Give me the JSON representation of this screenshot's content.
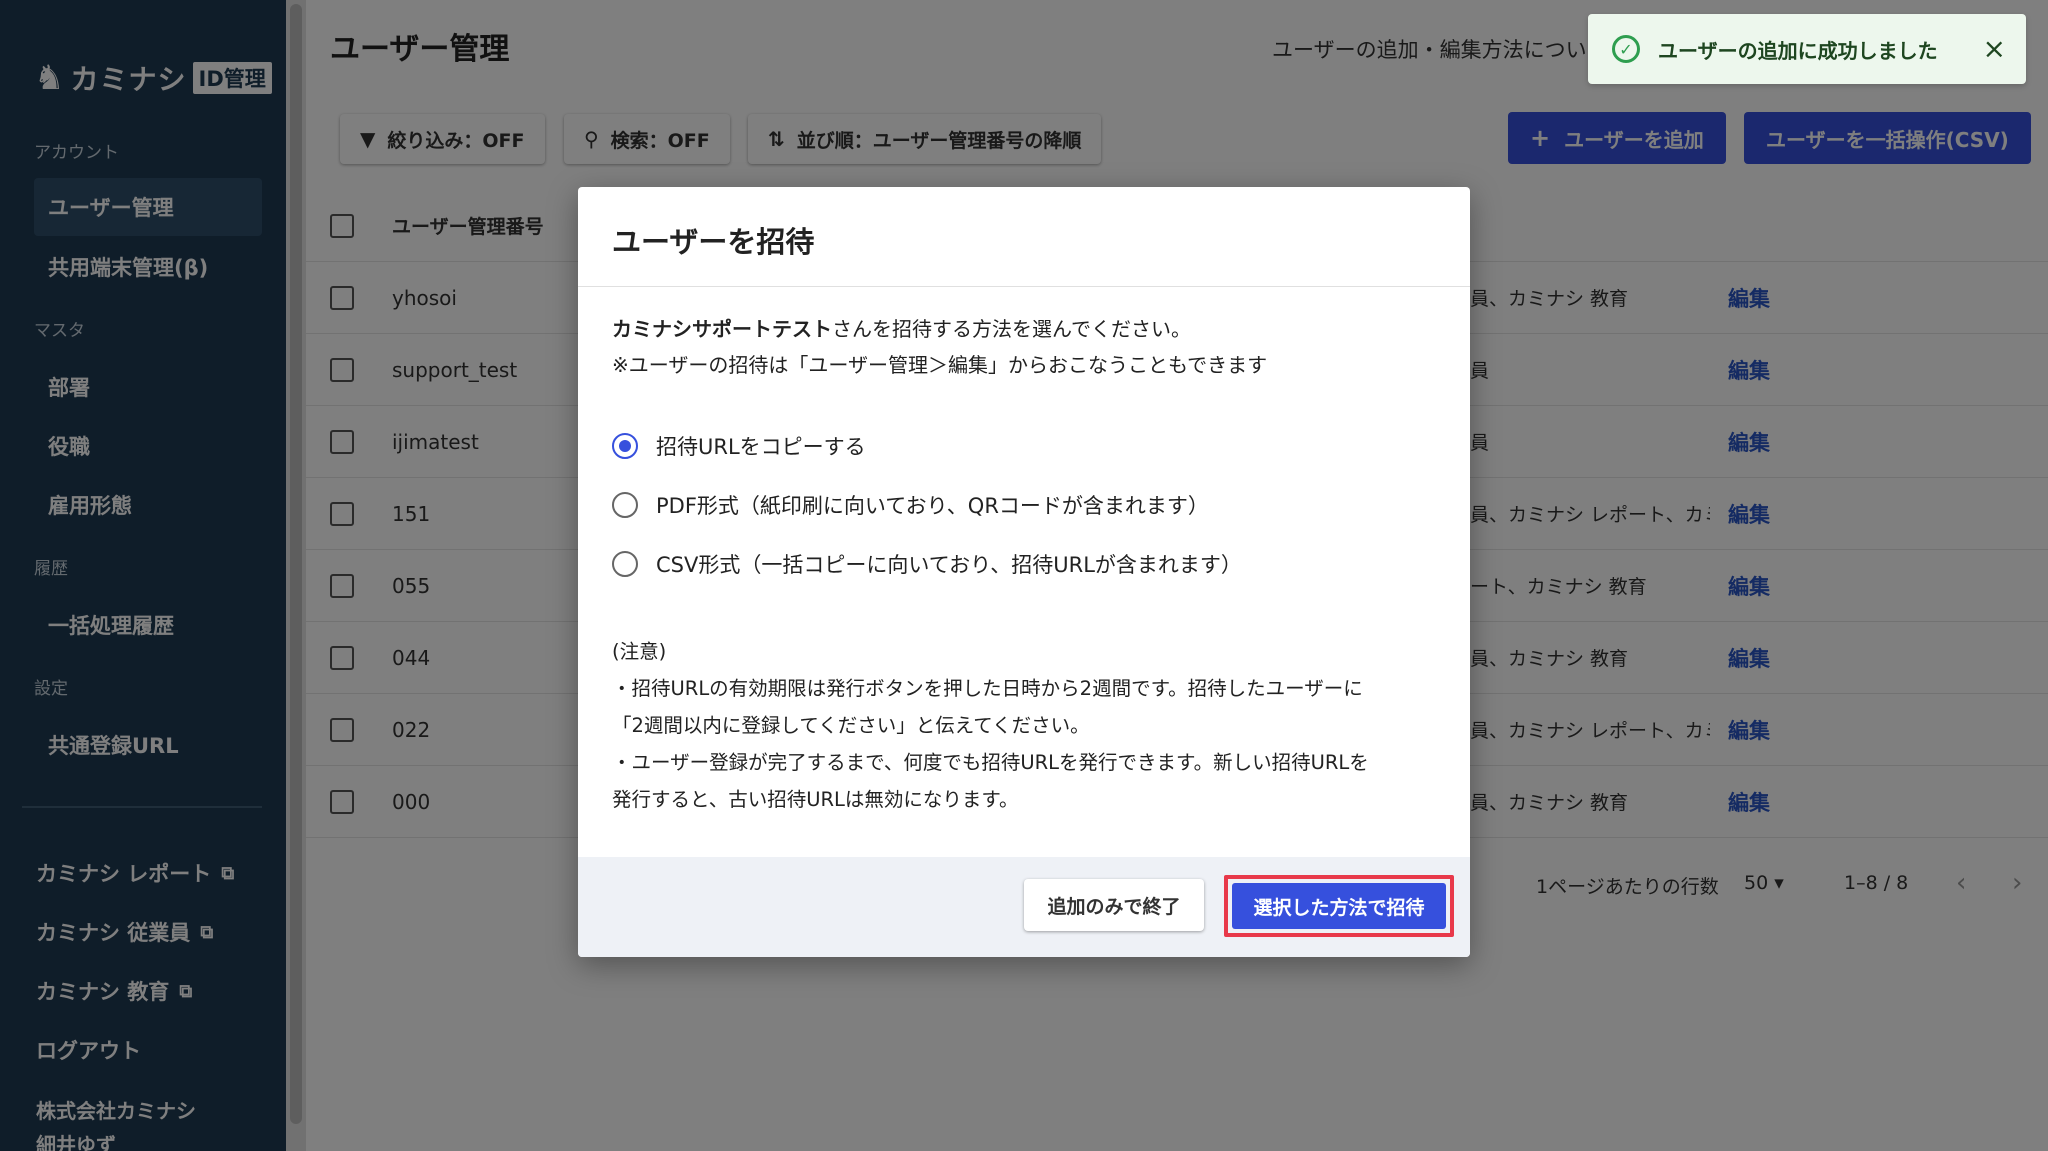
{
  "sidebar": {
    "brand": "カミナシ",
    "badge": "ID管理",
    "sections": {
      "account": "アカウント",
      "master": "マスタ",
      "history": "履歴",
      "settings": "設定"
    },
    "items": {
      "user_management": "ユーザー管理",
      "shared_device": "共用端末管理(β)",
      "department": "部署",
      "position": "役職",
      "employment": "雇用形態",
      "batch_history": "一括処理履歴",
      "common_url": "共通登録URL"
    },
    "external": {
      "report": "カミナシ レポート",
      "employee": "カミナシ 従業員",
      "education": "カミナシ 教育"
    },
    "logout": "ログアウト",
    "company": "株式会社カミナシ",
    "user": "細井ゆず"
  },
  "main": {
    "title": "ユーザー管理",
    "help_link": "ユーザーの追加・編集方法につい",
    "toolbar": {
      "filter": "絞り込み：OFF",
      "search": "検索：OFF",
      "sort": "並び順：ユーザー管理番号の降順",
      "add_user": "ユーザーを追加",
      "bulk_csv": "ユーザーを一括操作(CSV)"
    },
    "table": {
      "header_id": "ユーザー管理番号",
      "edit_label": "編集",
      "rows": [
        {
          "id": "yhosoi",
          "apps": "員、カミナシ 教育"
        },
        {
          "id": "support_test",
          "apps": "員"
        },
        {
          "id": "ijimatest",
          "apps": "員"
        },
        {
          "id": "151",
          "apps": "員、カミナシ レポート、カミ"
        },
        {
          "id": "055",
          "apps": "ート、カミナシ 教育"
        },
        {
          "id": "044",
          "apps": "員、カミナシ 教育"
        },
        {
          "id": "022",
          "apps": "員、カミナシ レポート、カミ"
        },
        {
          "id": "000",
          "apps": "員、カミナシ 教育"
        }
      ]
    },
    "pagination": {
      "rows_label": "1ページあたりの行数",
      "rows_value": "50",
      "range": "1–8 / 8"
    }
  },
  "toast": {
    "message": "ユーザーの追加に成功しました"
  },
  "modal": {
    "title": "ユーザーを招待",
    "desc_name": "カミナシサポートテスト",
    "desc_rest": "さんを招待する方法を選んでください。",
    "desc_line2": "※ユーザーの招待は「ユーザー管理＞編集」からおこなうこともできます",
    "options": [
      "招待URLをコピーする",
      "PDF形式（紙印刷に向いており、QRコードが含まれます）",
      "CSV形式（一括コピーに向いており、招待URLが含まれます）"
    ],
    "notes": {
      "heading": "(注意)",
      "line1": "・招待URLの有効期限は発行ボタンを押した日時から2週間です。招待したユーザーに",
      "line2": "「2週間以内に登録してください」と伝えてください。",
      "line3": "・ユーザー登録が完了するまで、何度でも招待URLを発行できます。新しい招待URLを",
      "line4": "発行すると、古い招待URLは無効になります。"
    },
    "secondary_button": "追加のみで終了",
    "primary_button": "選択した方法で招待"
  }
}
